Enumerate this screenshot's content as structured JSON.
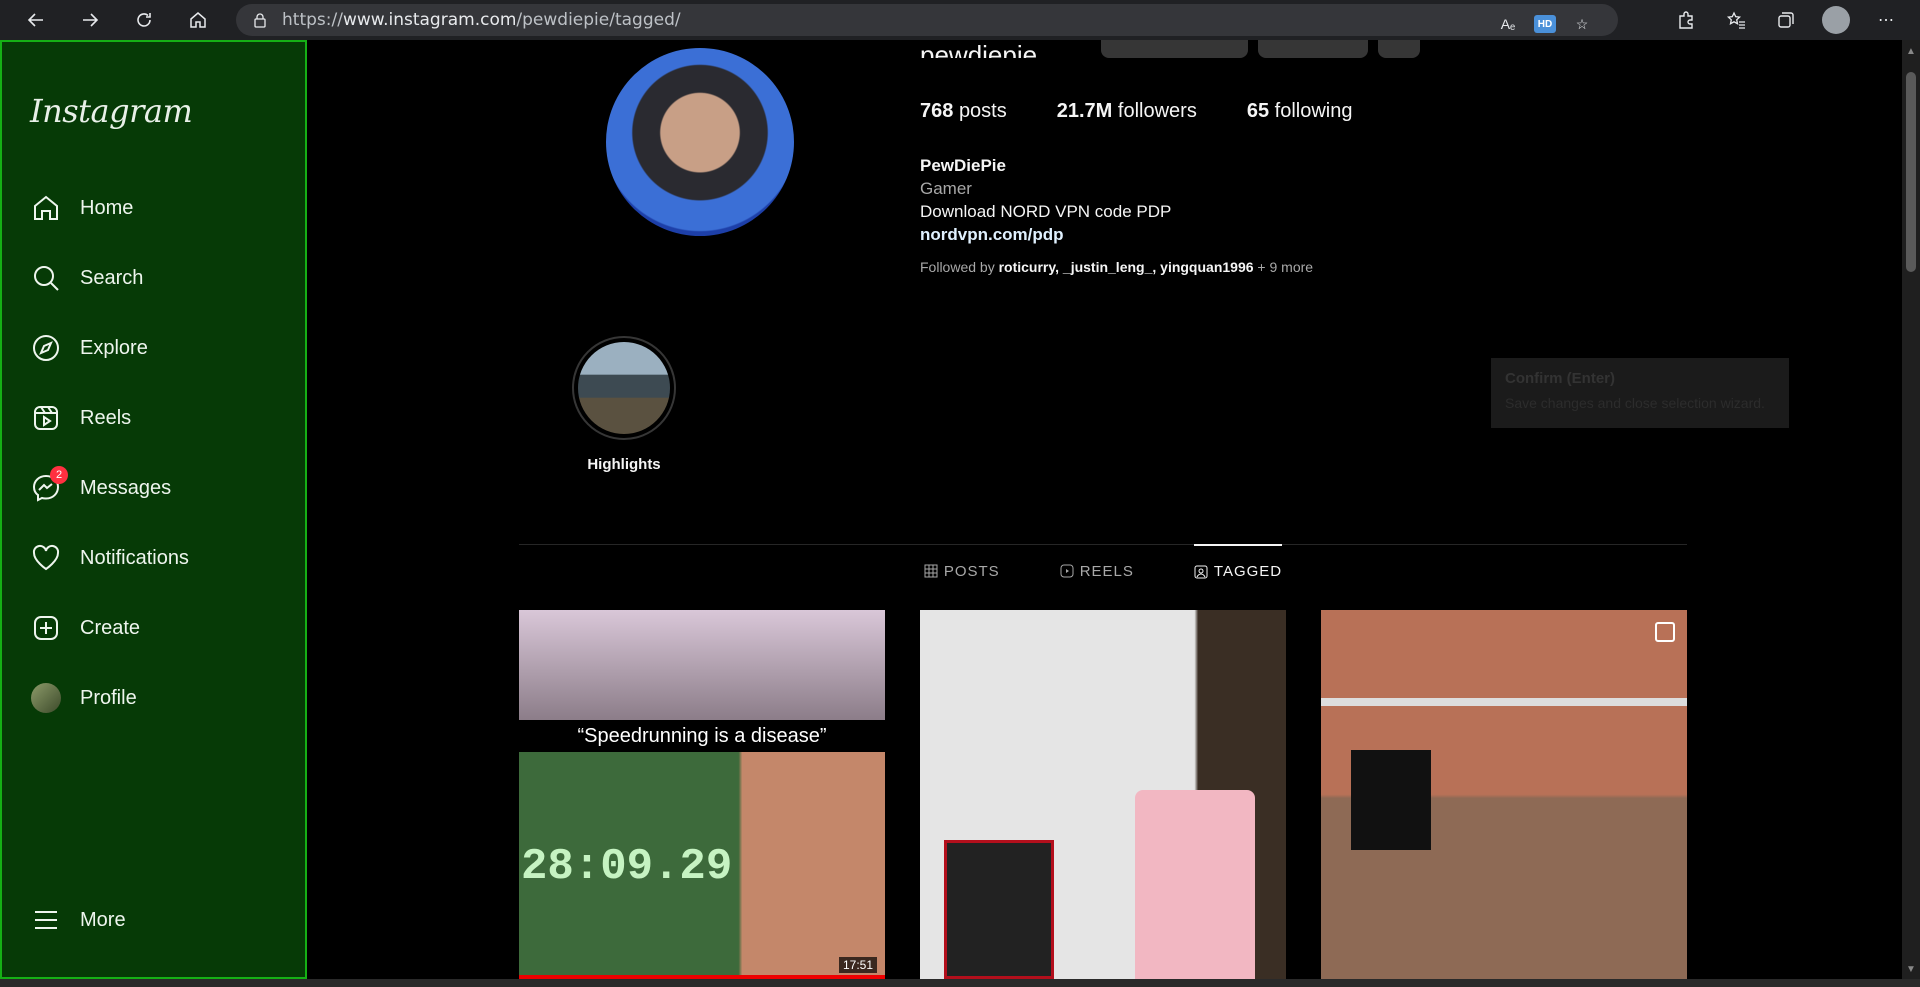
{
  "browser": {
    "url_prefix": "https://",
    "url_host": "www.instagram.com",
    "url_path": "/pewdiepie/tagged/",
    "hd_label": "HD",
    "read_aloud_label": "Aₑ"
  },
  "sidebar": {
    "logo": "Instagram",
    "items": [
      {
        "label": "Home"
      },
      {
        "label": "Search"
      },
      {
        "label": "Explore"
      },
      {
        "label": "Reels"
      },
      {
        "label": "Messages",
        "badge": "2"
      },
      {
        "label": "Notifications"
      },
      {
        "label": "Create"
      },
      {
        "label": "Profile"
      },
      {
        "label": "More"
      }
    ]
  },
  "profile": {
    "username": "pewdiepie",
    "stats": {
      "posts_count": "768",
      "posts_label": "posts",
      "followers_count": "21.7M",
      "followers_label": "followers",
      "following_count": "65",
      "following_label": "following"
    },
    "name": "PewDiePie",
    "category": "Gamer",
    "bio": "Download NORD VPN code PDP",
    "link": "nordvpn.com/pdp",
    "followed_by_prefix": "Followed by",
    "followed_by_names": "roticurry, _justin_leng_, yingquan1996",
    "followed_by_more": "+ 9 more"
  },
  "highlight": {
    "label": "Highlights"
  },
  "tooltip": {
    "title": "Confirm (Enter)",
    "description": "Save changes and close selection wizard."
  },
  "tabs": [
    {
      "label": "POSTS"
    },
    {
      "label": "REELS"
    },
    {
      "label": "TAGGED",
      "active": true
    }
  ],
  "posts": [
    {
      "caption": "“Speedrunning is a disease”",
      "timer": "28:09.29",
      "duration": "17:51"
    },
    {},
    {}
  ]
}
